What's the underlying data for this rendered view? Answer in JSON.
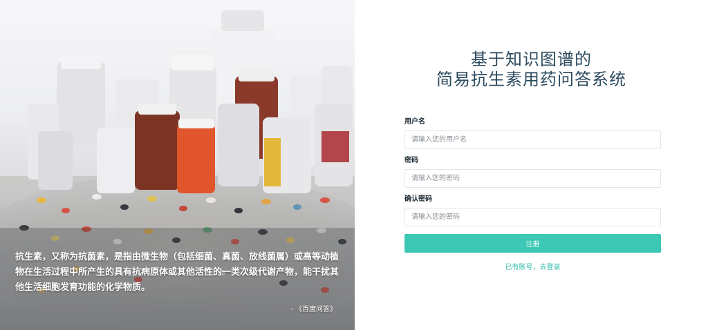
{
  "left": {
    "description": "抗生素，又称为抗菌素，是指由微生物（包括细菌、真菌、放线菌属）或高等动植物在生活过程中所产生的具有抗病原体或其他活性的一类次级代谢产物，能干扰其他生活细胞发育功能的化学物质。",
    "source": "- 《百度问答》"
  },
  "header": {
    "title_line1": "基于知识图谱的",
    "title_line2": "简易抗生素用药问答系统"
  },
  "form": {
    "username_label": "用户名",
    "username_placeholder": "请输入您的用户名",
    "password_label": "密码",
    "password_placeholder": "请输入您的密码",
    "confirm_label": "确认密码",
    "confirm_placeholder": "请输入您的密码",
    "submit_label": "注册",
    "login_link": "已有账号，去登录"
  },
  "colors": {
    "accent": "#3cc8b4",
    "title": "#2d4b5f"
  }
}
